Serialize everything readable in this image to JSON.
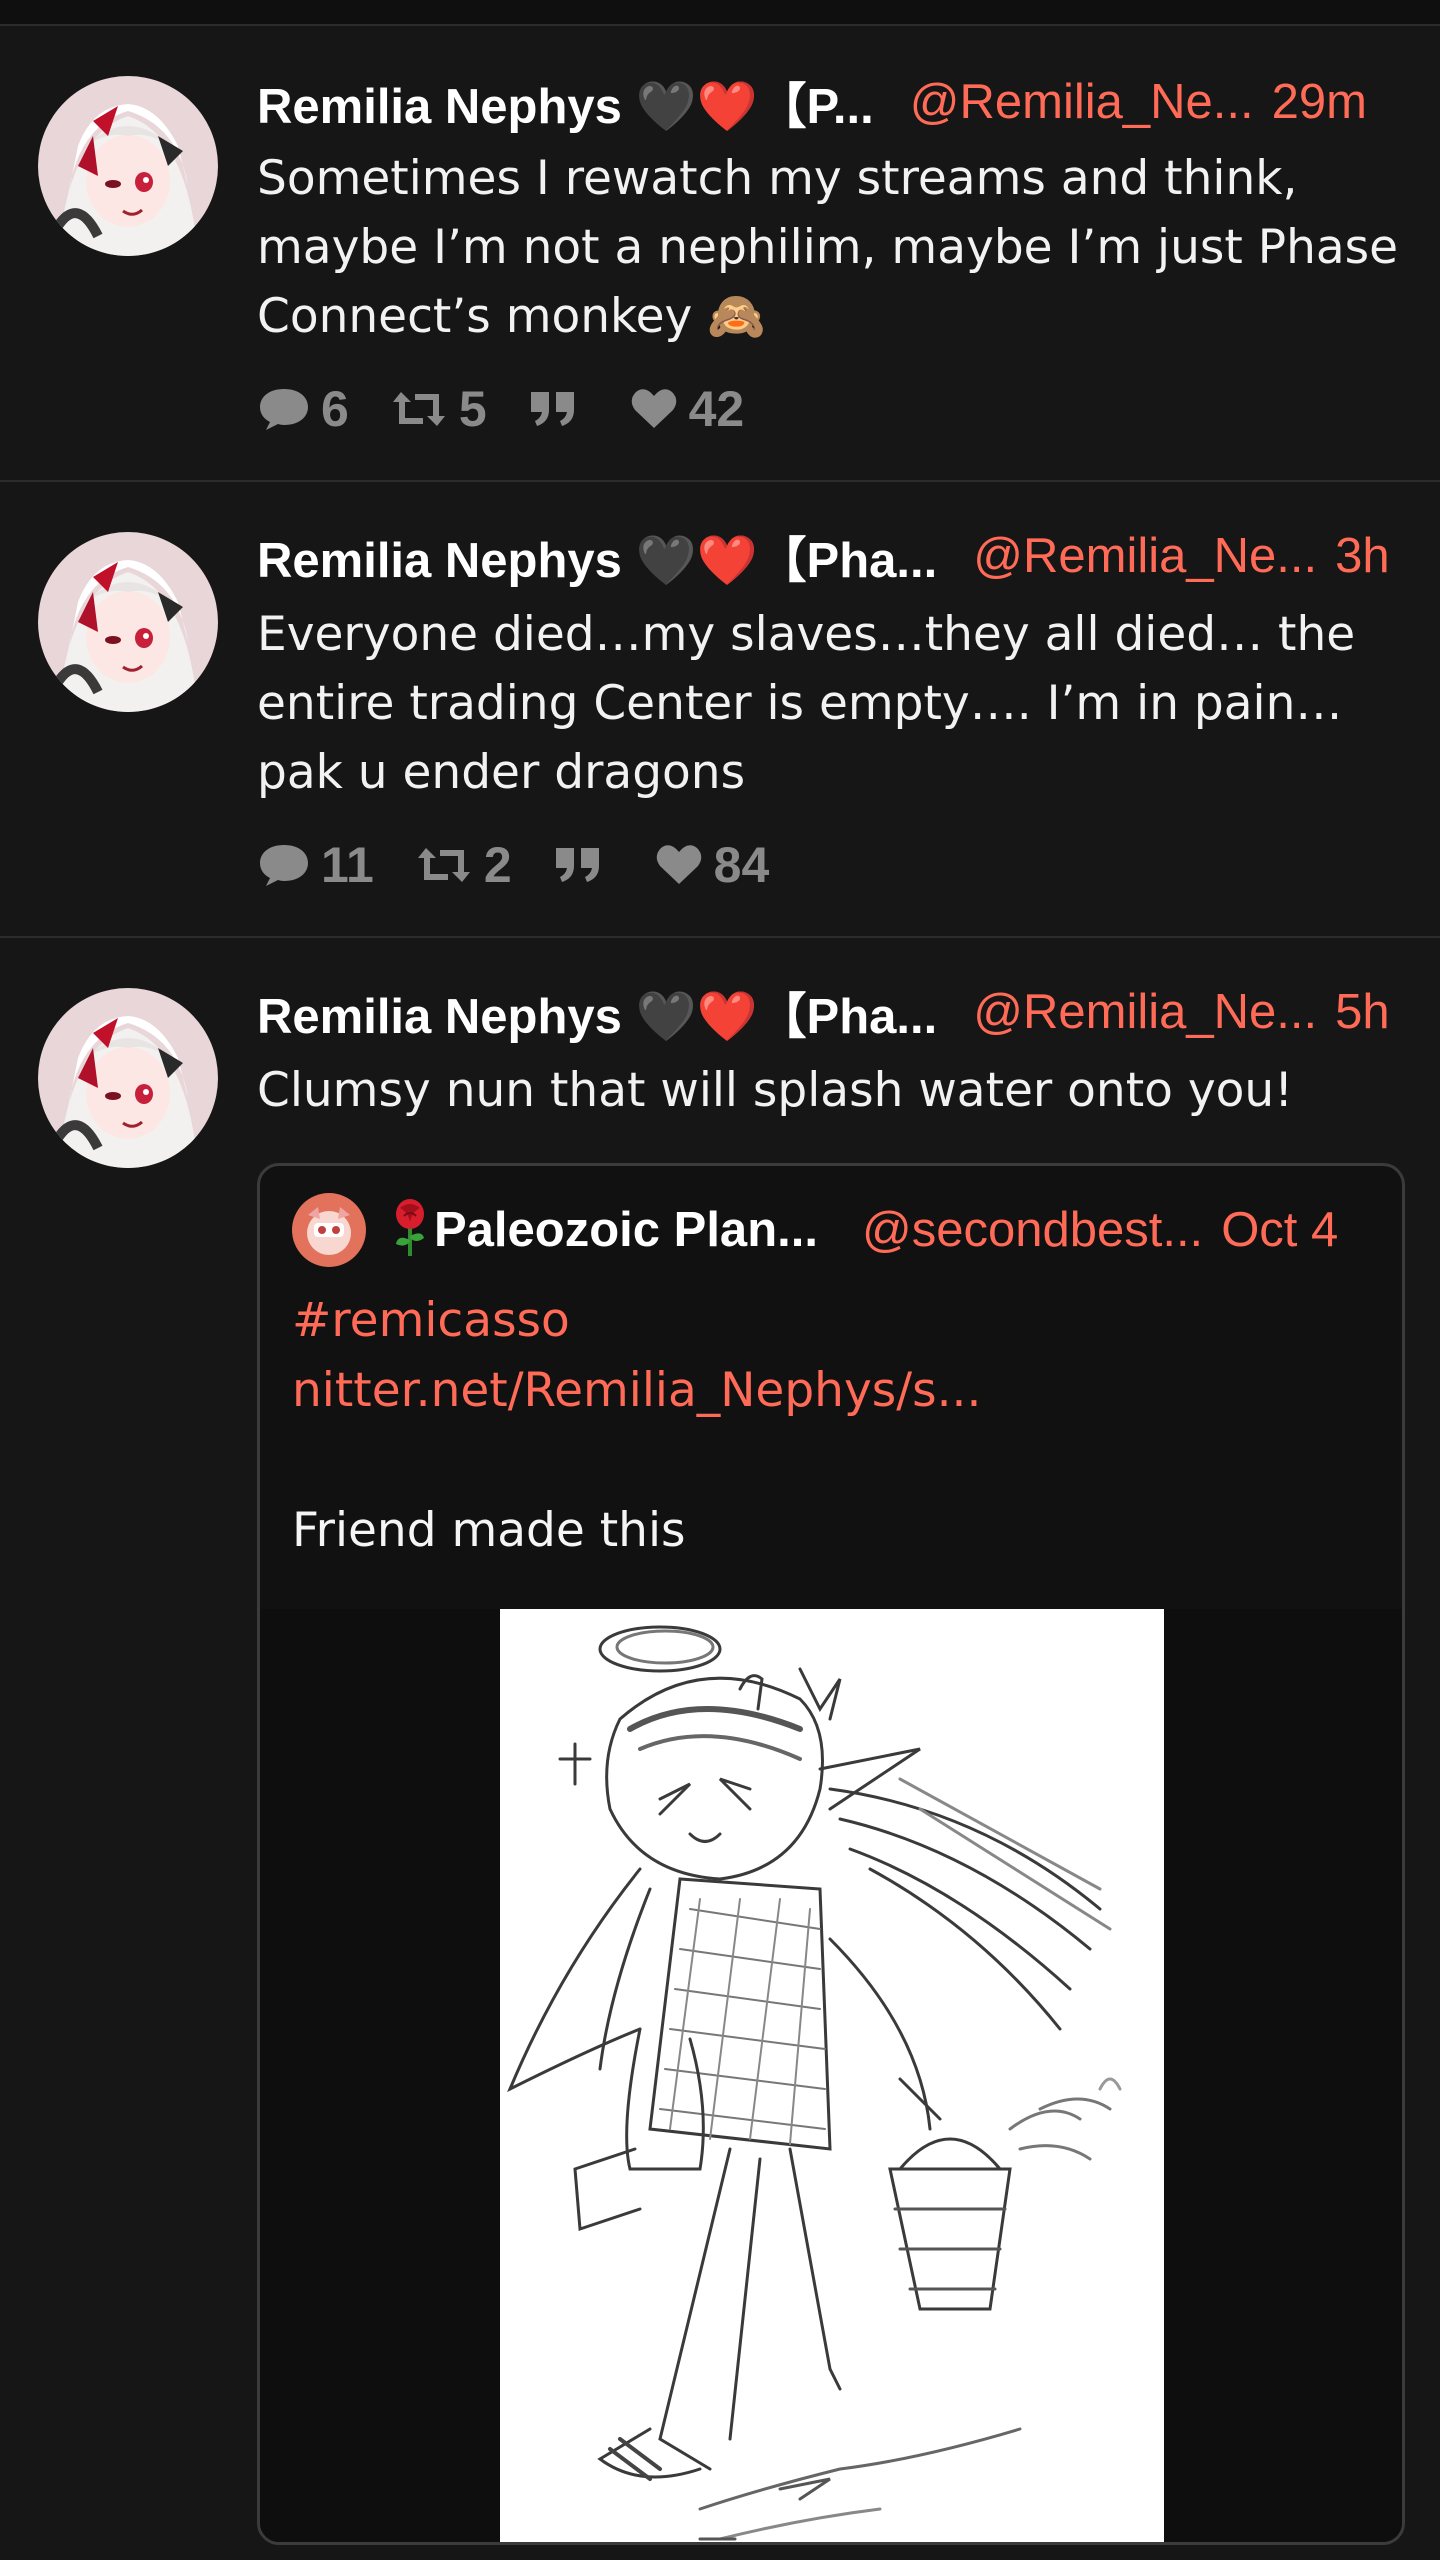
{
  "tweets": [
    {
      "name": "Remilia Nephys 🖤❤️【P...",
      "handle": "@Remilia_Ne...",
      "time": "29m",
      "text": "Sometimes I rewatch my streams and think, maybe I’m not a nephilim, maybe I’m just Phase Connect’s monkey 🙈",
      "stats": {
        "replies": "6",
        "retweets": "5",
        "likes": "42"
      }
    },
    {
      "name": "Remilia Nephys 🖤❤️【Pha...",
      "handle": "@Remilia_Ne...",
      "time": "3h",
      "text": "Everyone died…my slaves…they all died… the entire trading Center is empty…. I’m in pain… pak u ender dragons",
      "stats": {
        "replies": "11",
        "retweets": "2",
        "likes": "84"
      }
    },
    {
      "name": "Remilia Nephys 🖤❤️【Pha...",
      "handle": "@Remilia_Ne...",
      "time": "5h",
      "text": "Clumsy nun that will splash water onto you!"
    }
  ],
  "quote": {
    "emoji": "🌹",
    "name": "Paleozoic Plan...",
    "handle": "@secondbest...",
    "time": "Oct 4",
    "hashtag": "#remicasso",
    "link": "nitter.net/Remilia_Nephys/s...",
    "text": "Friend made this"
  },
  "colors": {
    "background": "#161616",
    "accent": "#ff6b57",
    "muted": "#8a8a8a",
    "divider": "#2c2c2c"
  },
  "icons": [
    "comment-icon",
    "retweet-icon",
    "quote-icon",
    "heart-icon"
  ]
}
